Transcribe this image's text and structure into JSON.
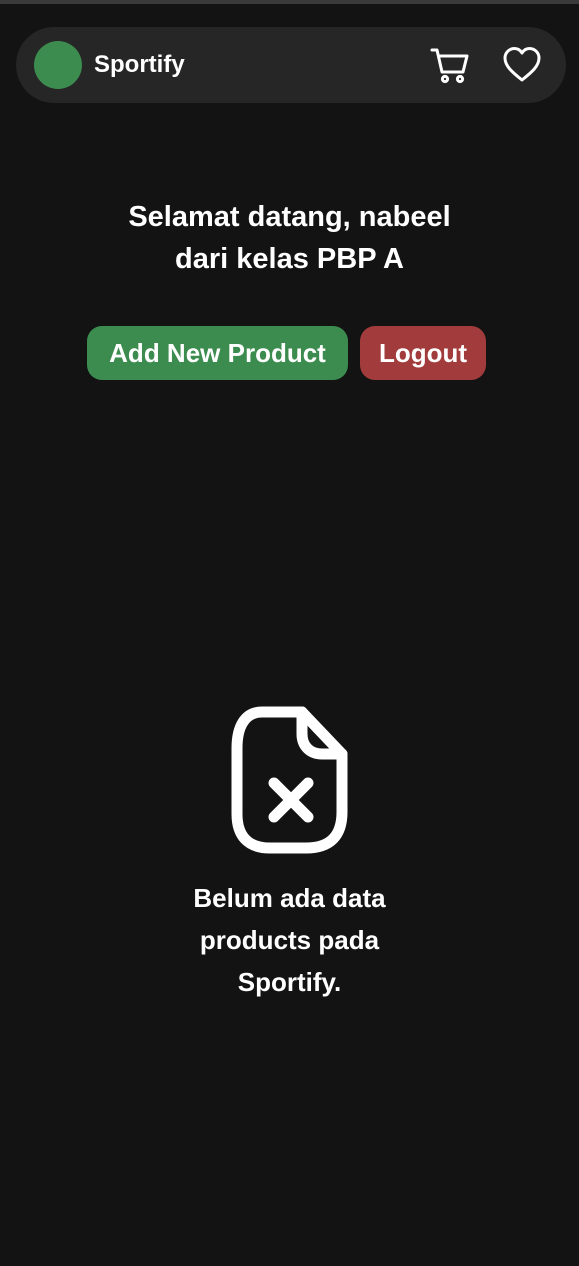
{
  "navbar": {
    "brand": "Sportify",
    "icons": [
      "avatar",
      "cart-icon",
      "heart-icon"
    ]
  },
  "welcome": {
    "line1": "Selamat datang, nabeel",
    "line2": "dari kelas PBP A"
  },
  "actions": {
    "add_product_label": "Add New Product",
    "logout_label": "Logout"
  },
  "empty_state": {
    "icon": "file-x-icon",
    "line1": "Belum ada data",
    "line2": "products pada",
    "line3": "Sportify."
  },
  "colors": {
    "background": "#131313",
    "navbar": "#262626",
    "accent_green": "#3d8c4f",
    "danger_red": "#a23b3b"
  }
}
